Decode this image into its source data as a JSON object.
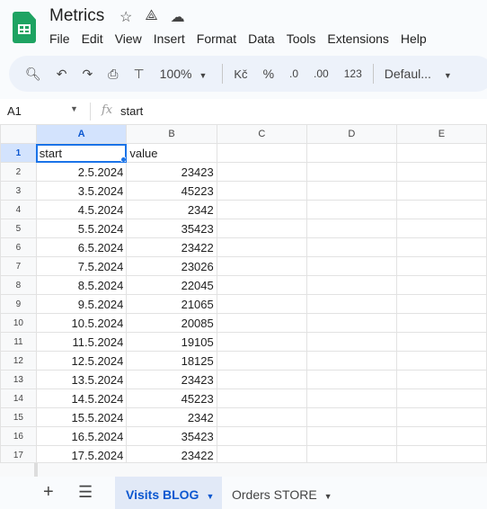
{
  "app": {
    "title": "Metrics",
    "icons": [
      "star-icon",
      "drive-add-icon",
      "cloud-saved-icon"
    ]
  },
  "menu": [
    "File",
    "Edit",
    "View",
    "Insert",
    "Format",
    "Data",
    "Tools",
    "Extensions",
    "Help"
  ],
  "toolbar": {
    "zoom": "100%",
    "currency": "Kč",
    "percent": "%",
    "decrease_decimal": ".0",
    "increase_decimal": ".00",
    "number_format": "123",
    "font": "Defaul..."
  },
  "formula_bar": {
    "cell_ref": "A1",
    "fx": "fx",
    "value": "start"
  },
  "columns": [
    "A",
    "B",
    "C",
    "D",
    "E"
  ],
  "rows": [
    [
      "1",
      "start",
      "value"
    ],
    [
      "2",
      "2.5.2024",
      "23423"
    ],
    [
      "3",
      "3.5.2024",
      "45223"
    ],
    [
      "4",
      "4.5.2024",
      "2342"
    ],
    [
      "5",
      "5.5.2024",
      "35423"
    ],
    [
      "6",
      "6.5.2024",
      "23422"
    ],
    [
      "7",
      "7.5.2024",
      "23026"
    ],
    [
      "8",
      "8.5.2024",
      "22045"
    ],
    [
      "9",
      "9.5.2024",
      "21065"
    ],
    [
      "10",
      "10.5.2024",
      "20085"
    ],
    [
      "11",
      "11.5.2024",
      "19105"
    ],
    [
      "12",
      "12.5.2024",
      "18125"
    ],
    [
      "13",
      "13.5.2024",
      "23423"
    ],
    [
      "14",
      "14.5.2024",
      "45223"
    ],
    [
      "15",
      "15.5.2024",
      "2342"
    ],
    [
      "16",
      "16.5.2024",
      "35423"
    ],
    [
      "17",
      "17.5.2024",
      "23422"
    ]
  ],
  "sheets": [
    {
      "label": "Visits BLOG",
      "active": true
    },
    {
      "label": "Orders STORE",
      "active": false
    }
  ],
  "colors": {
    "accent": "#0b57d0",
    "selection": "#1a73e8",
    "logo": "#1ea362"
  }
}
